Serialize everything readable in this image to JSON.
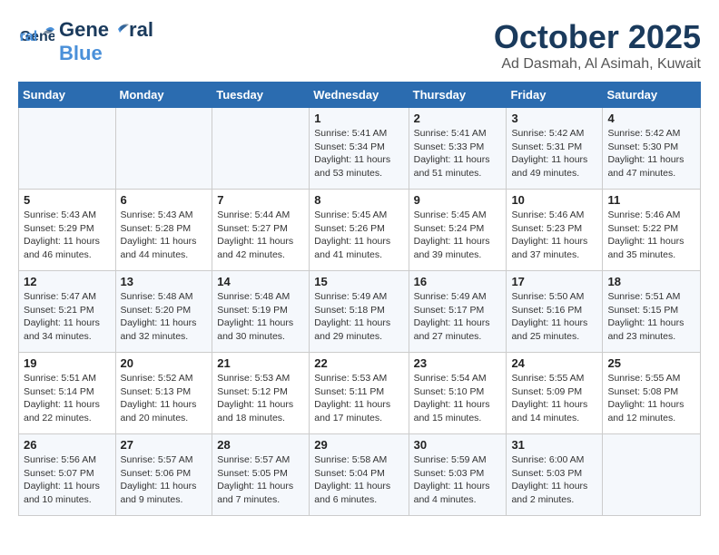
{
  "header": {
    "logo_line1": "General",
    "logo_line2": "Blue",
    "title": "October 2025",
    "subtitle": "Ad Dasmah, Al Asimah, Kuwait"
  },
  "days_of_week": [
    "Sunday",
    "Monday",
    "Tuesday",
    "Wednesday",
    "Thursday",
    "Friday",
    "Saturday"
  ],
  "weeks": [
    [
      {
        "day": "",
        "info": ""
      },
      {
        "day": "",
        "info": ""
      },
      {
        "day": "",
        "info": ""
      },
      {
        "day": "1",
        "info": "Sunrise: 5:41 AM\nSunset: 5:34 PM\nDaylight: 11 hours and 53 minutes."
      },
      {
        "day": "2",
        "info": "Sunrise: 5:41 AM\nSunset: 5:33 PM\nDaylight: 11 hours and 51 minutes."
      },
      {
        "day": "3",
        "info": "Sunrise: 5:42 AM\nSunset: 5:31 PM\nDaylight: 11 hours and 49 minutes."
      },
      {
        "day": "4",
        "info": "Sunrise: 5:42 AM\nSunset: 5:30 PM\nDaylight: 11 hours and 47 minutes."
      }
    ],
    [
      {
        "day": "5",
        "info": "Sunrise: 5:43 AM\nSunset: 5:29 PM\nDaylight: 11 hours and 46 minutes."
      },
      {
        "day": "6",
        "info": "Sunrise: 5:43 AM\nSunset: 5:28 PM\nDaylight: 11 hours and 44 minutes."
      },
      {
        "day": "7",
        "info": "Sunrise: 5:44 AM\nSunset: 5:27 PM\nDaylight: 11 hours and 42 minutes."
      },
      {
        "day": "8",
        "info": "Sunrise: 5:45 AM\nSunset: 5:26 PM\nDaylight: 11 hours and 41 minutes."
      },
      {
        "day": "9",
        "info": "Sunrise: 5:45 AM\nSunset: 5:24 PM\nDaylight: 11 hours and 39 minutes."
      },
      {
        "day": "10",
        "info": "Sunrise: 5:46 AM\nSunset: 5:23 PM\nDaylight: 11 hours and 37 minutes."
      },
      {
        "day": "11",
        "info": "Sunrise: 5:46 AM\nSunset: 5:22 PM\nDaylight: 11 hours and 35 minutes."
      }
    ],
    [
      {
        "day": "12",
        "info": "Sunrise: 5:47 AM\nSunset: 5:21 PM\nDaylight: 11 hours and 34 minutes."
      },
      {
        "day": "13",
        "info": "Sunrise: 5:48 AM\nSunset: 5:20 PM\nDaylight: 11 hours and 32 minutes."
      },
      {
        "day": "14",
        "info": "Sunrise: 5:48 AM\nSunset: 5:19 PM\nDaylight: 11 hours and 30 minutes."
      },
      {
        "day": "15",
        "info": "Sunrise: 5:49 AM\nSunset: 5:18 PM\nDaylight: 11 hours and 29 minutes."
      },
      {
        "day": "16",
        "info": "Sunrise: 5:49 AM\nSunset: 5:17 PM\nDaylight: 11 hours and 27 minutes."
      },
      {
        "day": "17",
        "info": "Sunrise: 5:50 AM\nSunset: 5:16 PM\nDaylight: 11 hours and 25 minutes."
      },
      {
        "day": "18",
        "info": "Sunrise: 5:51 AM\nSunset: 5:15 PM\nDaylight: 11 hours and 23 minutes."
      }
    ],
    [
      {
        "day": "19",
        "info": "Sunrise: 5:51 AM\nSunset: 5:14 PM\nDaylight: 11 hours and 22 minutes."
      },
      {
        "day": "20",
        "info": "Sunrise: 5:52 AM\nSunset: 5:13 PM\nDaylight: 11 hours and 20 minutes."
      },
      {
        "day": "21",
        "info": "Sunrise: 5:53 AM\nSunset: 5:12 PM\nDaylight: 11 hours and 18 minutes."
      },
      {
        "day": "22",
        "info": "Sunrise: 5:53 AM\nSunset: 5:11 PM\nDaylight: 11 hours and 17 minutes."
      },
      {
        "day": "23",
        "info": "Sunrise: 5:54 AM\nSunset: 5:10 PM\nDaylight: 11 hours and 15 minutes."
      },
      {
        "day": "24",
        "info": "Sunrise: 5:55 AM\nSunset: 5:09 PM\nDaylight: 11 hours and 14 minutes."
      },
      {
        "day": "25",
        "info": "Sunrise: 5:55 AM\nSunset: 5:08 PM\nDaylight: 11 hours and 12 minutes."
      }
    ],
    [
      {
        "day": "26",
        "info": "Sunrise: 5:56 AM\nSunset: 5:07 PM\nDaylight: 11 hours and 10 minutes."
      },
      {
        "day": "27",
        "info": "Sunrise: 5:57 AM\nSunset: 5:06 PM\nDaylight: 11 hours and 9 minutes."
      },
      {
        "day": "28",
        "info": "Sunrise: 5:57 AM\nSunset: 5:05 PM\nDaylight: 11 hours and 7 minutes."
      },
      {
        "day": "29",
        "info": "Sunrise: 5:58 AM\nSunset: 5:04 PM\nDaylight: 11 hours and 6 minutes."
      },
      {
        "day": "30",
        "info": "Sunrise: 5:59 AM\nSunset: 5:03 PM\nDaylight: 11 hours and 4 minutes."
      },
      {
        "day": "31",
        "info": "Sunrise: 6:00 AM\nSunset: 5:03 PM\nDaylight: 11 hours and 2 minutes."
      },
      {
        "day": "",
        "info": ""
      }
    ]
  ]
}
